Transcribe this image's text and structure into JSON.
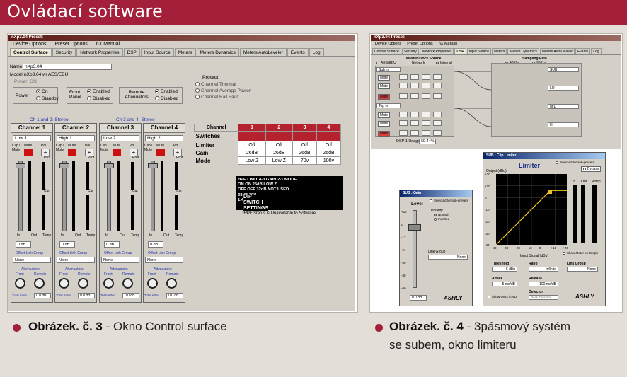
{
  "header": {
    "title": "Ovládací software"
  },
  "left": {
    "titlebar": "nXp3.04    Preset:",
    "menu": [
      "Device Options",
      "Preset Options",
      "nX Manual"
    ],
    "tabs": [
      "Control Surface",
      "Security",
      "Network Properties",
      "DSP",
      "Input Source",
      "Meters",
      "Meters Dynamics",
      "Meters AutoLeveler",
      "Events",
      "Log"
    ],
    "name_label": "Name",
    "name_value": "nXp3.04",
    "model_label": "Model",
    "model_value": "nXp3.04 w/ AES/EBU",
    "power_line": "Power: ON",
    "power": {
      "label": "Power",
      "opts": [
        "On",
        "Standby"
      ]
    },
    "front": {
      "label": "Front Panel",
      "opts": [
        "Enabled",
        "Disabled"
      ]
    },
    "remote": {
      "label": "Remote Attenuators",
      "opts": [
        "Enabled",
        "Disabled"
      ]
    },
    "protect": {
      "title": "Protect",
      "items": [
        "Channel Thermal",
        "Channel Average Power",
        "Channel Rail Fault"
      ]
    },
    "stereo": [
      "Ch 1 and 2: Stereo",
      "Ch 3 and 4: Stereo"
    ],
    "channels": [
      {
        "title": "Channel 1",
        "name": "Low 1",
        "db": "0 dB",
        "combo": "None",
        "attn": "0.0 dB"
      },
      {
        "title": "Channel 2",
        "name": "High 1",
        "db": "0 dB",
        "combo": "None",
        "attn": "0.0 dB"
      },
      {
        "title": "Channel 3",
        "name": "Low 2",
        "db": "0 dB",
        "combo": "None",
        "attn": "0.0 dB"
      },
      {
        "title": "Channel 4",
        "name": "High 2",
        "db": "0 dB",
        "combo": "None",
        "attn": "0.0 dB"
      }
    ],
    "ch_labels": {
      "clip": "Clip / Mute",
      "mute": "Mute",
      "pol": "Pol",
      "prot": "Prot",
      "cur": "Cur",
      "in": "In",
      "out": "Out",
      "temp": "Temp",
      "offset": "Offset Link Group",
      "attenuators": "Attenuators",
      "front": "Front",
      "remote": "Remote",
      "total": "Total Atten"
    },
    "table": {
      "header": [
        "Channel",
        "1",
        "2",
        "3",
        "4"
      ],
      "rows": [
        {
          "label": "Switches",
          "cells": [
            "",
            "",
            "",
            ""
          ]
        },
        {
          "label": "Limiter",
          "cells": [
            "Off",
            "Off",
            "Off",
            "Off"
          ]
        },
        {
          "label": "Gain",
          "cells": [
            "26dB",
            "26dB",
            "26dB",
            "26dB"
          ]
        },
        {
          "label": "Mode",
          "cells": [
            "Low Z",
            "Low Z",
            "70v",
            "100v"
          ]
        }
      ]
    },
    "dip": {
      "lines": [
        "HPF  LIMIT  4-3 GAIN   2-1 MODE",
        "ON   ON     26dB      LOW Z",
        "OFF  OFF    32dB      NOT USED",
        "              38dB      70V",
        "              1.4V      100V"
      ],
      "title": "DIP SWITCH SETTINGS",
      "note": "*HPF Status is Unavailable to Software"
    }
  },
  "right": {
    "titlebar": "nXp3.04    Preset:",
    "menu": [
      "Device Options",
      "Preset Options",
      "nX Manual"
    ],
    "tabs": [
      "Control Surface",
      "Security",
      "Network Properties",
      "DSP",
      "Input Source",
      "Meters",
      "Meters Dynamics",
      "Meters AutoLeveler",
      "Events",
      "Log"
    ],
    "master_clock": "Master Clock Source",
    "clock_opts": [
      "AES/EBU",
      "Network",
      "Internal"
    ],
    "sampling": "Sampling Rate",
    "rate_opts": [
      "48Khz",
      "96Khz"
    ],
    "inputs": [
      "Sub in",
      "Top in"
    ],
    "outputs": [
      "SUB",
      "LO",
      "MID",
      "HI"
    ],
    "mute": "Mute",
    "dsp_usage_label": "DSP 1 Usage:",
    "dsp_usage": "69.44%",
    "gain_win": {
      "title": "SUB : Gain",
      "level": "Level",
      "polarity": "Polarity",
      "pol_opts": [
        "Normal",
        "Inverted"
      ],
      "check": "Selected for sub-presets",
      "link": "Link Group",
      "link_val": "None",
      "value": "0.0 dB",
      "brand": "ASHLY",
      "scale": [
        "+12",
        "0",
        "-12",
        "-24",
        "-36",
        "-48",
        "-60"
      ]
    },
    "lim_win": {
      "title": "SUB : Clip Limiter",
      "heading": "Limiter",
      "check": "Selected for sub-presets",
      "bypass": "Bypass",
      "output": "Output (dBu)",
      "input": "Input Signal (dBu)",
      "show_meter": "Show Meter on Graph",
      "threshold": "Threshold",
      "threshold_val": "6 dBu",
      "ratio": "Ratio",
      "ratio_val": "Infinite",
      "link": "Link Group",
      "link_val": "None",
      "attack": "Attack",
      "attack_val": "5 ms/dB",
      "release": "Release",
      "release_val": "100 ms/dB",
      "detector": "Detector",
      "detector_val": "Peak Detector",
      "units": "Show Units in VU",
      "in": "In",
      "out": "Out",
      "atten": "Atten",
      "brand": "ASHLY",
      "yticks": [
        "+20",
        "+10",
        "0",
        "-10",
        "-20",
        "-30",
        "-40"
      ],
      "xticks": [
        "-40",
        "-30",
        "-20",
        "-10",
        "0",
        "+10",
        "+20"
      ]
    }
  },
  "captions": [
    {
      "bold": "Obrázek. č. 3",
      "text": " - Okno Control surface"
    },
    {
      "bold": "Obrázek. č. 4",
      "text": " - 3pásmový systém",
      "line2": "se subem, okno limiteru"
    }
  ],
  "colors": {
    "band": "#a31f3a",
    "table_head": "#b5222e",
    "mute": "#cc1111",
    "graph_line": "#f0c020"
  }
}
